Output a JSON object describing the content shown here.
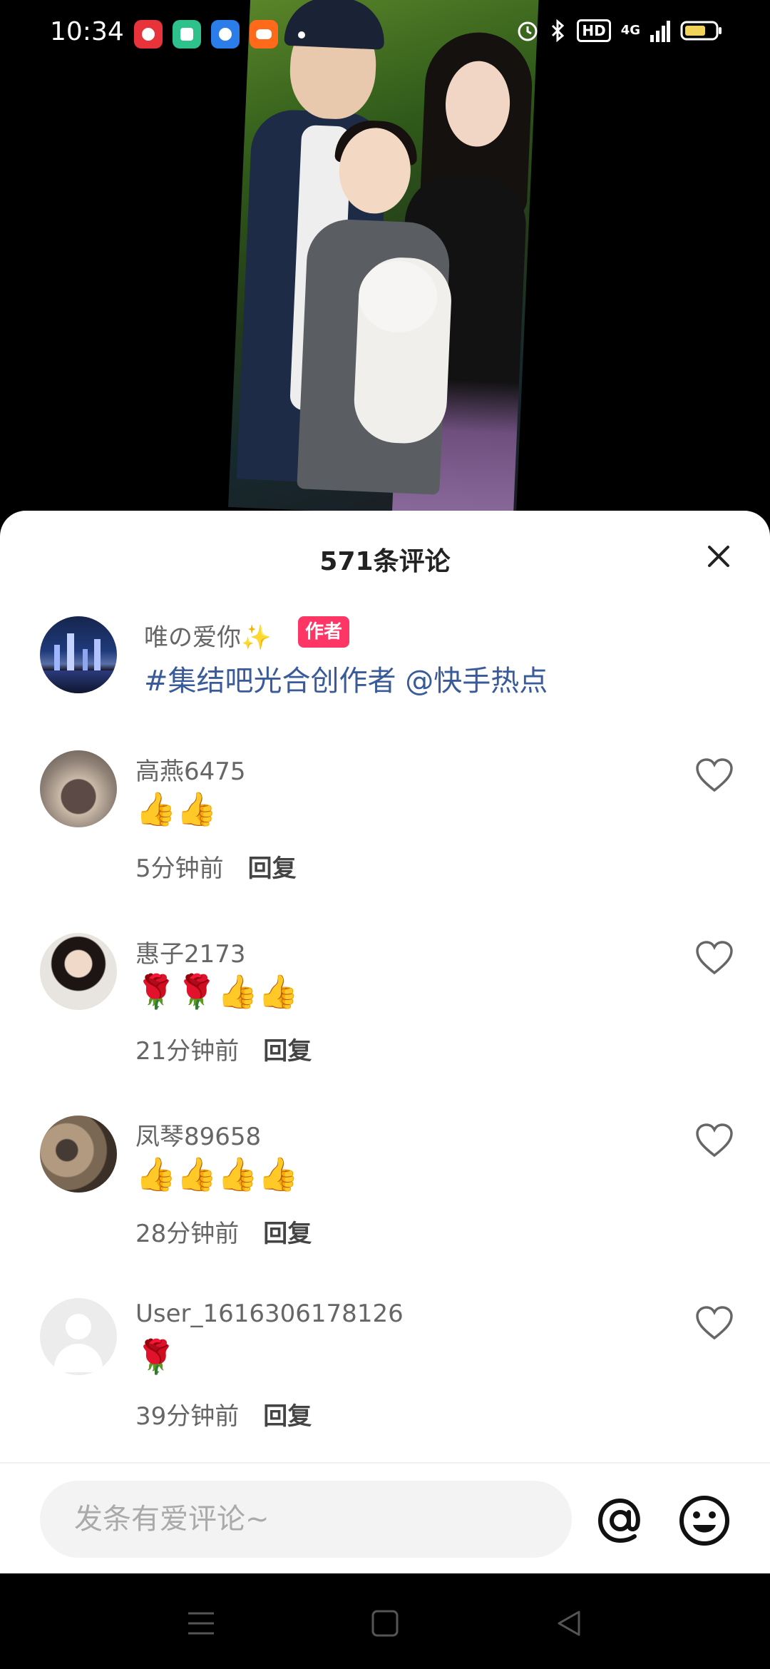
{
  "status_bar": {
    "time": "10:34",
    "network": "4G",
    "hd": "HD"
  },
  "app_icons": [
    {
      "name": "video-app-icon",
      "color": "#e8333a"
    },
    {
      "name": "green-app-icon",
      "color": "#2fc18c"
    },
    {
      "name": "blue-app-icon",
      "color": "#2b7de9"
    },
    {
      "name": "kuaishou-app-icon",
      "color": "#ff6a1a"
    }
  ],
  "sheet": {
    "title": "571条评论"
  },
  "author_post": {
    "name": "唯の爱你✨",
    "badge": "作者",
    "text": "#集结吧光合创作者  @快手热点"
  },
  "comments": [
    {
      "name": "高燕6475",
      "text": "👍👍",
      "time": "5分钟前",
      "reply": "回复"
    },
    {
      "name": "惠子2173",
      "text": "🌹🌹👍👍",
      "time": "21分钟前",
      "reply": "回复"
    },
    {
      "name": "凤琴89658",
      "text": "👍👍👍👍",
      "time": "28分钟前",
      "reply": "回复"
    },
    {
      "name": "User_1616306178126",
      "text": "🌹",
      "time": "39分钟前",
      "reply": "回复"
    }
  ],
  "input": {
    "placeholder": "发条有爱评论~"
  },
  "colors": {
    "accent_badge": "#fe3666",
    "link": "#3a5b99"
  }
}
